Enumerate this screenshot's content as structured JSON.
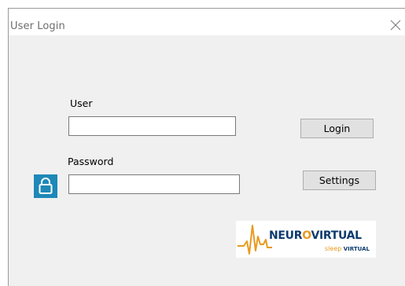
{
  "window": {
    "title": "User Login",
    "close_icon": "close-icon"
  },
  "form": {
    "user_label": "User",
    "user_value": "",
    "password_label": "Password",
    "password_value": "",
    "lock_icon": "lock-icon"
  },
  "buttons": {
    "login_label": "Login",
    "settings_label": "Settings"
  },
  "logo": {
    "part1": "NEUR",
    "part2": "O",
    "part3": "VIRTUAL",
    "sub_sleep": "sleep",
    "sub_virtual": "VIRTUAL"
  },
  "colors": {
    "accent_blue": "#1e88b8",
    "logo_navy": "#0d3b6e",
    "logo_orange": "#e89a1f"
  }
}
